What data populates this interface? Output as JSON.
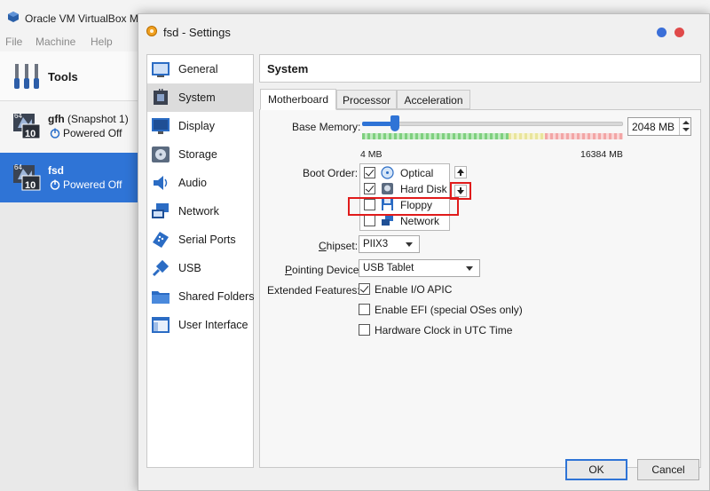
{
  "main_window": {
    "title": "Oracle VM VirtualBox Ma",
    "menu": [
      "File",
      "Machine",
      "Help"
    ],
    "tools_label": "Tools",
    "vms": [
      {
        "name": "gfh",
        "snapshot": "(Snapshot 1)",
        "state": "Powered Off",
        "badge": "10",
        "arch": "64",
        "selected": false
      },
      {
        "name": "fsd",
        "snapshot": "",
        "state": "Powered Off",
        "badge": "10",
        "arch": "64",
        "selected": true
      }
    ],
    "selection_color": "#2f74d6"
  },
  "dialog": {
    "title": "fsd - Settings",
    "categories": [
      {
        "label": "General",
        "icon": "general-icon"
      },
      {
        "label": "System",
        "icon": "system-icon",
        "active": true
      },
      {
        "label": "Display",
        "icon": "display-icon"
      },
      {
        "label": "Storage",
        "icon": "storage-icon"
      },
      {
        "label": "Audio",
        "icon": "audio-icon"
      },
      {
        "label": "Network",
        "icon": "network-icon"
      },
      {
        "label": "Serial Ports",
        "icon": "serial-ports-icon"
      },
      {
        "label": "USB",
        "icon": "usb-icon"
      },
      {
        "label": "Shared Folders",
        "icon": "shared-folders-icon"
      },
      {
        "label": "User Interface",
        "icon": "user-interface-icon"
      }
    ],
    "page_title": "System",
    "tabs": [
      {
        "label": "Motherboard",
        "active": true
      },
      {
        "label": "Processor",
        "active": false
      },
      {
        "label": "Acceleration",
        "active": false
      }
    ],
    "motherboard": {
      "base_memory_label": "Base Memory:",
      "base_memory_value": "2048 MB",
      "slider_min_label": "4 MB",
      "slider_max_label": "16384 MB",
      "slider_fraction": 0.125,
      "boot_order_label": "Boot Order:",
      "boot_devices": [
        {
          "label": "Optical",
          "checked": true,
          "icon": "optical-disc-icon"
        },
        {
          "label": "Hard Disk",
          "checked": true,
          "icon": "hard-disk-icon"
        },
        {
          "label": "Floppy",
          "checked": false,
          "icon": "floppy-icon"
        },
        {
          "label": "Network",
          "checked": false,
          "icon": "network-icon"
        }
      ],
      "chipset_label": "Chipset:",
      "chipset_value": "PIIX3",
      "pointing_label": "Pointing Device:",
      "pointing_value": "USB Tablet",
      "extended_label": "Extended Features:",
      "features": [
        {
          "label": "Enable I/O APIC",
          "checked": true
        },
        {
          "label": "Enable EFI (special OSes only)",
          "checked": false
        },
        {
          "label": "Hardware Clock in UTC Time",
          "checked": false
        }
      ]
    },
    "buttons": {
      "ok": "OK",
      "cancel": "Cancel"
    },
    "highlight_color": "#e01b1b",
    "accent_color": "#2f74d6"
  }
}
